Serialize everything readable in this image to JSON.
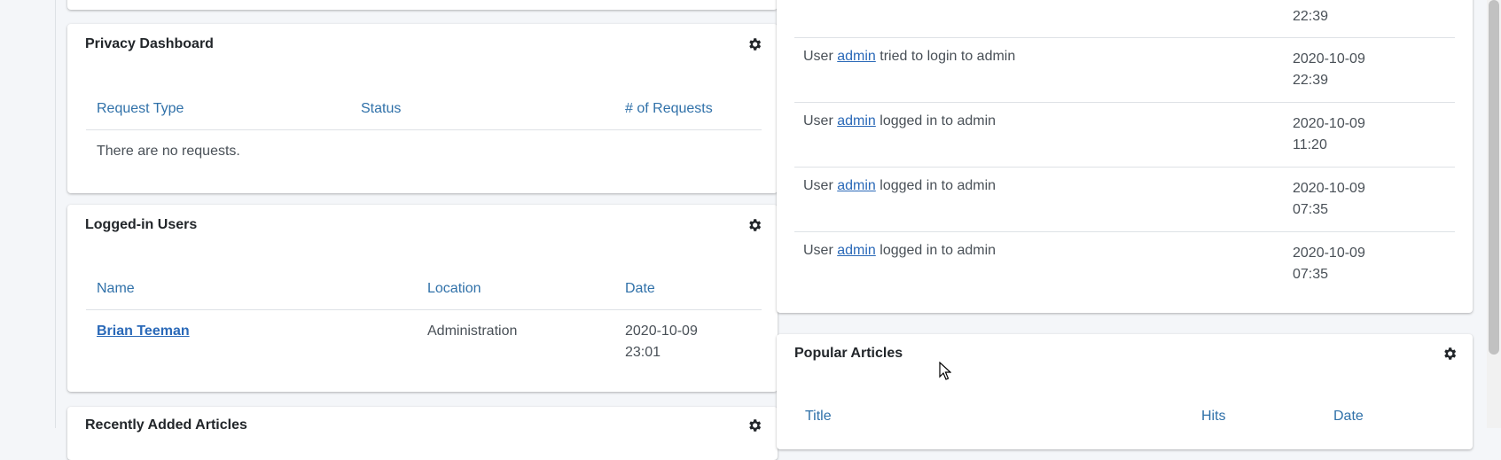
{
  "privacy_dashboard": {
    "title": "Privacy Dashboard",
    "columns": [
      "Request Type",
      "Status",
      "# of Requests"
    ],
    "empty_message": "There are no requests."
  },
  "logged_in_users": {
    "title": "Logged-in Users",
    "columns": [
      "Name",
      "Location",
      "Date"
    ],
    "rows": [
      {
        "name": "Brian Teeman",
        "location": "Administration",
        "date_line1": "2020-10-09",
        "date_line2": "23:01"
      }
    ]
  },
  "recently_added_articles": {
    "title": "Recently Added Articles"
  },
  "activity_log": {
    "top_partial_date_line2": "22:39",
    "rows": [
      {
        "prefix": "User",
        "user": "admin",
        "action": "tried to login to admin",
        "date_line1": "2020-10-09",
        "date_line2": "22:39"
      },
      {
        "prefix": "User",
        "user": "admin",
        "action": "logged in to admin",
        "date_line1": "2020-10-09",
        "date_line2": "11:20"
      },
      {
        "prefix": "User",
        "user": "admin",
        "action": "logged in to admin",
        "date_line1": "2020-10-09",
        "date_line2": "07:35"
      },
      {
        "prefix": "User",
        "user": "admin",
        "action": "logged in to admin",
        "date_line1": "2020-10-09",
        "date_line2": "07:35"
      }
    ]
  },
  "popular_articles": {
    "title": "Popular Articles",
    "columns": [
      "Title",
      "Hits",
      "Date"
    ]
  },
  "icons": {
    "settings": "gear-icon",
    "pointer": "mouse-cursor-icon"
  },
  "colors": {
    "link": "#2a69b8",
    "header_link": "#3071a9",
    "title": "#22262a",
    "background": "#f4f6f9"
  }
}
